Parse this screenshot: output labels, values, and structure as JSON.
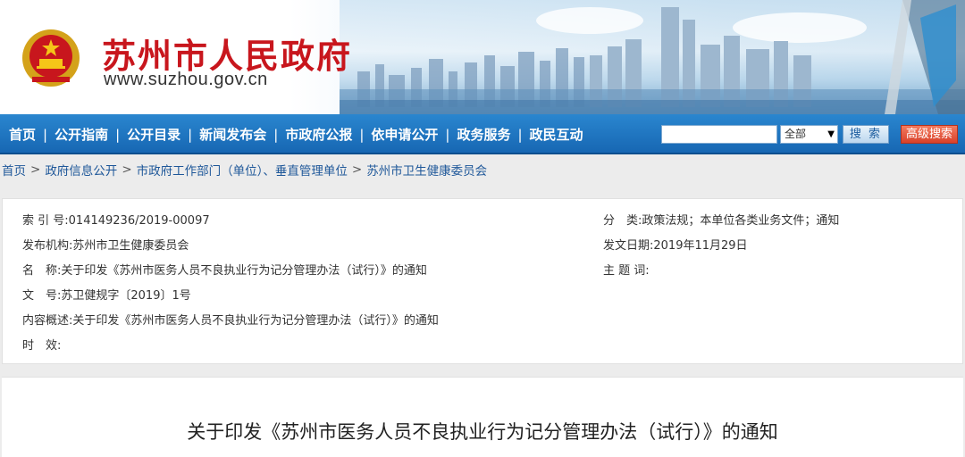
{
  "header": {
    "site_title": "苏州市人民政府",
    "site_url": "www.suzhou.gov.cn"
  },
  "nav": {
    "items": [
      "首页",
      "公开指南",
      "公开目录",
      "新闻发布会",
      "市政府公报",
      "依申请公开",
      "政务服务",
      "政民互动"
    ],
    "separator": "|",
    "search_select": "全部",
    "search_button": "搜 索",
    "advanced_search": "高级搜索"
  },
  "breadcrumb": [
    "首页",
    "政府信息公开",
    "市政府工作部门（单位）、垂直管理单位",
    "苏州市卫生健康委员会"
  ],
  "info": {
    "index_label": "索 引 号:",
    "index_value": "014149236/2019-00097",
    "publisher_label": "发布机构:",
    "publisher_value": "苏州市卫生健康委员会",
    "name_label": "名　称:",
    "name_value": "关于印发《苏州市医务人员不良执业行为记分管理办法（试行）》的通知",
    "docno_label": "文　号:",
    "docno_value": "苏卫健规字〔2019〕1号",
    "summary_label": "内容概述:",
    "summary_value": "关于印发《苏州市医务人员不良执业行为记分管理办法（试行）》的通知",
    "validity_label": "时　效:",
    "validity_value": "",
    "category_label": "分　类:",
    "category_value": "政策法规；本单位各类业务文件；通知",
    "date_label": "发文日期:",
    "date_value": "2019年11月29日",
    "keywords_label": "主 题 词:",
    "keywords_value": ""
  },
  "document": {
    "title": "关于印发《苏州市医务人员不良执业行为记分管理办法（试行）》的通知"
  },
  "colors": {
    "brand_red": "#c8161d",
    "nav_blue": "#1767b3",
    "link_blue": "#1e5799"
  }
}
